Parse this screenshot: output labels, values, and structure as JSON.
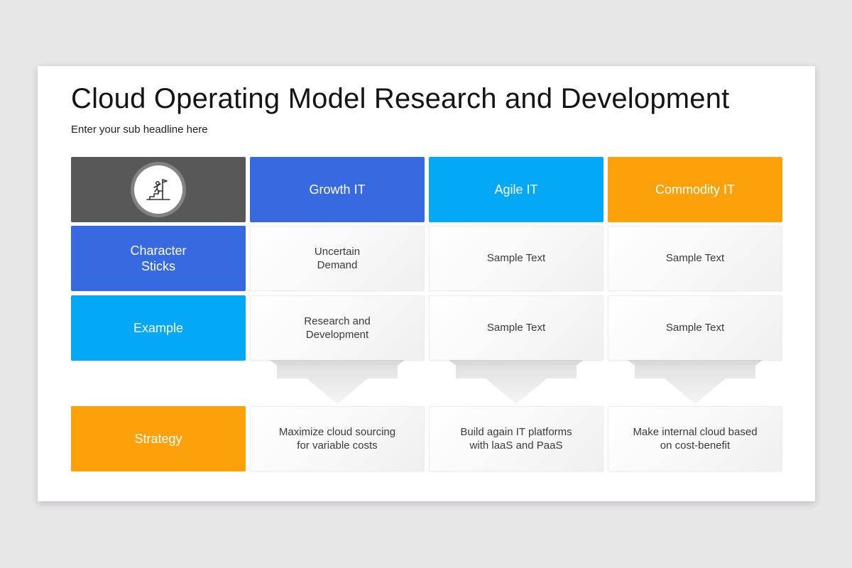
{
  "title": "Cloud Operating Model Research and Development",
  "subtitle": "Enter your sub headline here",
  "header_icon": "leader-on-steps-icon",
  "columns": [
    {
      "label": "Growth IT",
      "color": "#3769e0"
    },
    {
      "label": "Agile IT",
      "color": "#03a8f6"
    },
    {
      "label": "Commodity IT",
      "color": "#fda10b"
    }
  ],
  "header_icon_bg": "#585858",
  "rows": [
    {
      "label": "Character\nSticks",
      "color": "#3769e0",
      "cells": [
        "Uncertain\nDemand",
        "Sample Text",
        "Sample Text"
      ]
    },
    {
      "label": "Example",
      "color": "#03a8f6",
      "cells": [
        "Research and\nDevelopment",
        "Sample Text",
        "Sample Text"
      ]
    }
  ],
  "strategy": {
    "label": "Strategy",
    "color": "#fda10b",
    "cells": [
      "Maximize cloud sourcing\nfor variable costs",
      "Build again IT platforms\nwith laaS and PaaS",
      "Make internal cloud based\non cost-benefit"
    ]
  }
}
